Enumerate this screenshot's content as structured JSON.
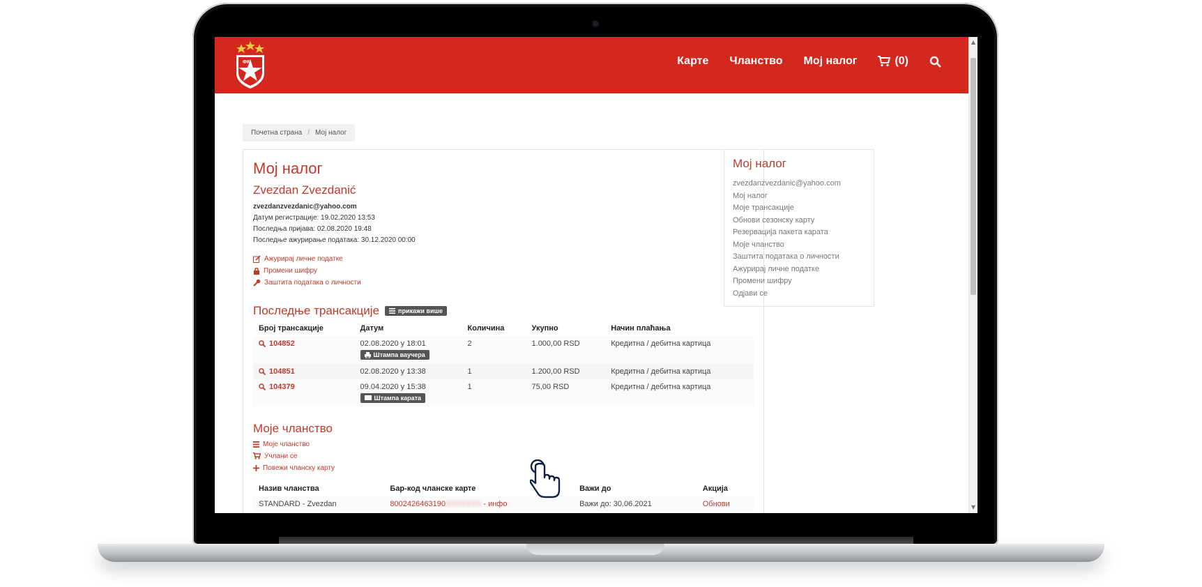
{
  "header": {
    "nav": [
      "Карте",
      "Чланство",
      "Мој налог"
    ],
    "cart_label": "(0)",
    "logo_text": "ФК",
    "icons": {
      "cart": "cart-icon",
      "search": "search-icon"
    }
  },
  "breadcrumb": {
    "home": "Почетна страна",
    "current": "Мој налог"
  },
  "account": {
    "title": "Мој налог",
    "user_name": "Zvezdan Zvezdanić",
    "email": "zvezdanzvezdanic@yahoo.com",
    "registered": "Датум регистрације: 19.02.2020 13:53",
    "last_login": "Последња пријава: 02.08.2020 19:48",
    "last_update": "Последње ажурирање података: 30.12.2020 00:00",
    "links": [
      "Ажурирај личне податке",
      "Промени шифру",
      "Заштита података о личности"
    ]
  },
  "transactions": {
    "title": "Последње трансакције",
    "show_more": "прикажи више",
    "columns": [
      "Број трансакције",
      "Датум",
      "Количина",
      "Укупно",
      "Начин плаћања"
    ],
    "rows": [
      {
        "id": "104852",
        "date": "02.08.2020 у 18:01",
        "qty": "2",
        "total": "1.000,00 RSD",
        "payment": "Кредитна / дебитна картица",
        "action": "Штампа ваучера"
      },
      {
        "id": "104851",
        "date": "02.08.2020 у 13:38",
        "qty": "1",
        "total": "1.200,00 RSD",
        "payment": "Кредитна / дебитна картица",
        "action": ""
      },
      {
        "id": "104379",
        "date": "09.04.2020 у 15:38",
        "qty": "1",
        "total": "75,00 RSD",
        "payment": "Кредитна / дебитна картица",
        "action": "Штампа карата"
      }
    ]
  },
  "membership": {
    "title": "Моје чланство",
    "links": [
      "Моје чланство",
      "Учлани се",
      "Повежи чланску карту"
    ],
    "columns": [
      "Назив чланства",
      "Бар-код чланске карте",
      "Важи до",
      "Акција"
    ],
    "row": {
      "name": "STANDARD - Zvezdan",
      "barcode": "8002426463190",
      "barcode_hidden": "XXXXXXX",
      "info": "- инфо",
      "valid": "Важи до: 30.06.2021",
      "action": "Обнови"
    }
  },
  "sidebar": {
    "title": "Мој налог",
    "items": [
      "zvezdanzvezdanic@yahoo.com",
      "Мој налог",
      "Моје трансакције",
      "Обнови сезонску карту",
      "Резервација пакета карата",
      "Моје чланство",
      "Заштита података о личности",
      "Ажурирај личне податке",
      "Промени шифру",
      "Одјави се"
    ]
  },
  "colors": {
    "brand_red": "#d4271e",
    "link_red": "#c0392b"
  }
}
